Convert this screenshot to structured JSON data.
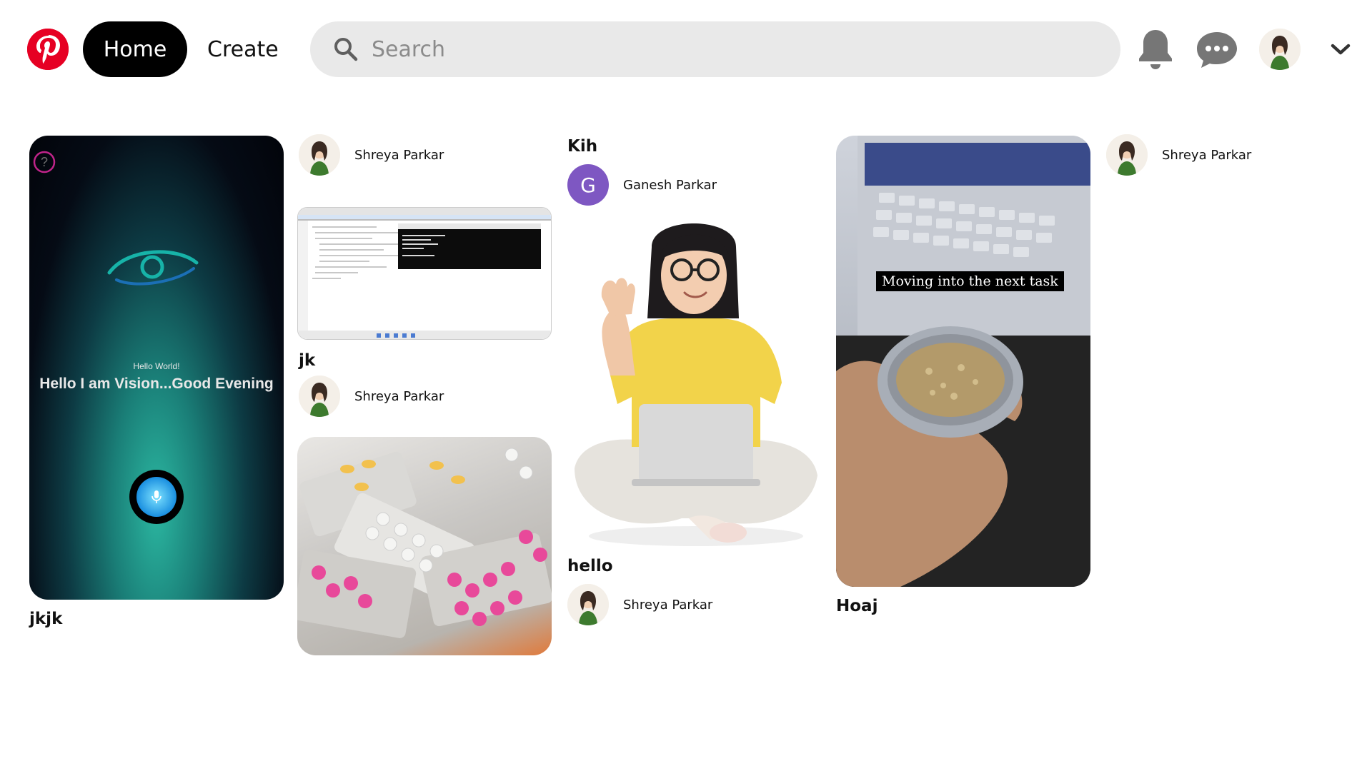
{
  "header": {
    "home_label": "Home",
    "create_label": "Create",
    "search_placeholder": "Search",
    "logo_icon": "pinterest-logo",
    "notifications_icon": "bell-icon",
    "messages_icon": "chat-bubble-icon",
    "menu_icon": "chevron-down-icon"
  },
  "colors": {
    "brand": "#e60023",
    "nav_active_bg": "#000000",
    "search_bg": "#e9e9e9",
    "icon_gray": "#767676",
    "letter_avatar_bg": "#7e57c2"
  },
  "pins": [
    {
      "title": "jkjk",
      "image_text_small": "Hello World!",
      "image_text_big": "Hello I am Vision...Good Evening"
    },
    {
      "author": "Shreya Parkar",
      "title": "jk"
    },
    {
      "author": "Shreya Parkar"
    },
    {
      "title": "Kih",
      "author": "Ganesh Parkar",
      "author_initial": "G"
    },
    {
      "title": "hello",
      "author": "Shreya Parkar"
    },
    {
      "title": "Hoaj",
      "image_caption": "Moving into the next task"
    },
    {
      "author": "Shreya Parkar"
    }
  ]
}
